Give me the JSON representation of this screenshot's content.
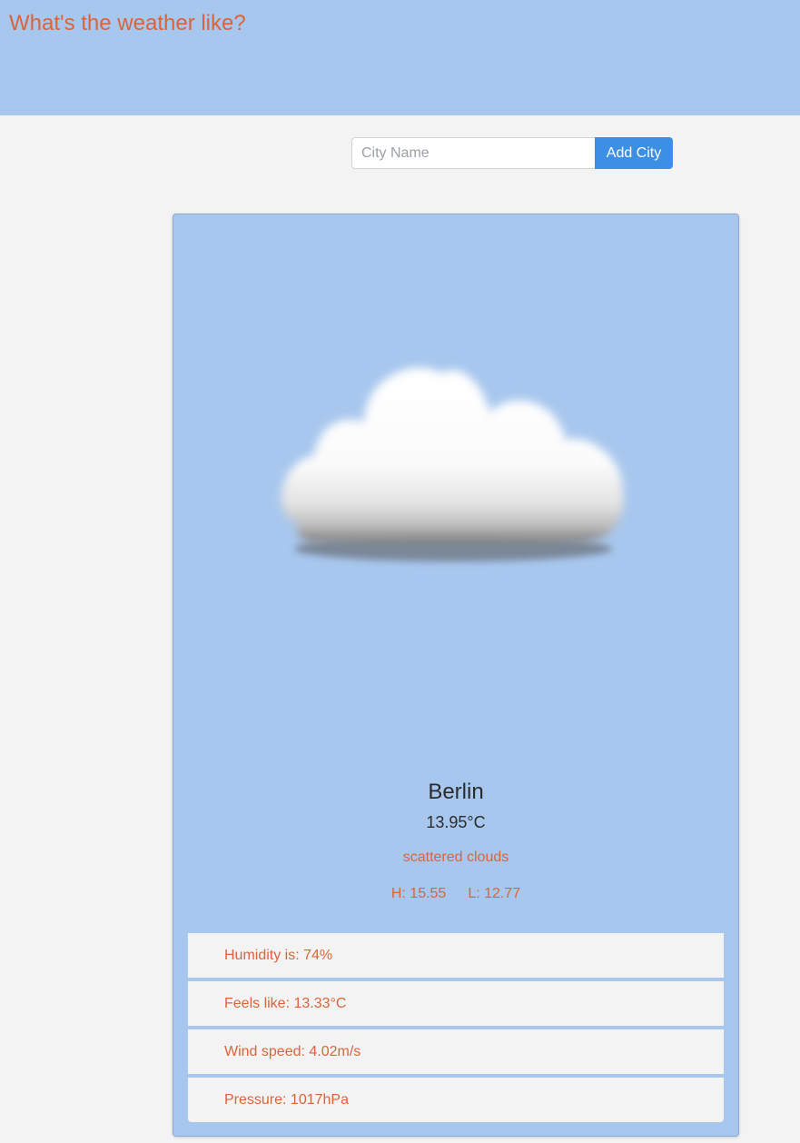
{
  "header": {
    "title": "What's the weather like?"
  },
  "search": {
    "placeholder": "City Name",
    "value": "",
    "button_label": "Add City"
  },
  "card": {
    "icon": "cloud-icon",
    "city": "Berlin",
    "temperature": "13.95°C",
    "description": "scattered clouds",
    "high": "H: 15.55",
    "low": "L: 12.77",
    "details": [
      {
        "label": "Humidity is: 74%"
      },
      {
        "label": "Feels like: 13.33°C"
      },
      {
        "label": "Wind speed: 4.02m/s"
      },
      {
        "label": "Pressure: 1017hPa"
      }
    ]
  },
  "colors": {
    "header_bg": "#a8c7ee",
    "accent_text": "#d9643a",
    "button_bg": "#3d8fe6",
    "page_bg": "#f3f3f3"
  }
}
